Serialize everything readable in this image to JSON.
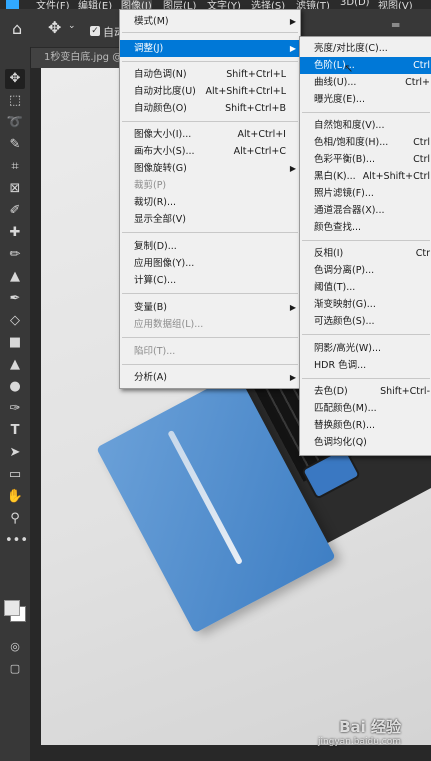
{
  "menubar": {
    "items": [
      "文件(F)",
      "编辑(E)",
      "图像(I)",
      "图层(L)",
      "文字(Y)",
      "选择(S)",
      "滤镜(T)",
      "3D(D)",
      "视图(V)"
    ]
  },
  "optbar": {
    "autoselect_label": "自动"
  },
  "tab": {
    "title": "1秒变白底.jpg @"
  },
  "image_menu": {
    "items": [
      {
        "label": "模式(M)",
        "shortcut": "",
        "submenu": true
      },
      {
        "label": "调整(J)",
        "shortcut": "",
        "submenu": true
      },
      {
        "label": "自动色调(N)",
        "shortcut": "Shift+Ctrl+L"
      },
      {
        "label": "自动对比度(U)",
        "shortcut": "Alt+Shift+Ctrl+L"
      },
      {
        "label": "自动颜色(O)",
        "shortcut": "Shift+Ctrl+B"
      },
      {
        "label": "图像大小(I)...",
        "shortcut": "Alt+Ctrl+I"
      },
      {
        "label": "画布大小(S)...",
        "shortcut": "Alt+Ctrl+C"
      },
      {
        "label": "图像旋转(G)",
        "shortcut": "",
        "submenu": true
      },
      {
        "label": "裁剪(P)",
        "shortcut": ""
      },
      {
        "label": "裁切(R)...",
        "shortcut": ""
      },
      {
        "label": "显示全部(V)",
        "shortcut": ""
      },
      {
        "label": "复制(D)...",
        "shortcut": ""
      },
      {
        "label": "应用图像(Y)...",
        "shortcut": ""
      },
      {
        "label": "计算(C)...",
        "shortcut": ""
      },
      {
        "label": "变量(B)",
        "shortcut": "",
        "submenu": true
      },
      {
        "label": "应用数据组(L)...",
        "shortcut": ""
      },
      {
        "label": "陷印(T)...",
        "shortcut": ""
      },
      {
        "label": "分析(A)",
        "shortcut": "",
        "submenu": true
      }
    ]
  },
  "adjust_menu": {
    "items": [
      {
        "label": "亮度/对比度(C)...",
        "shortcut": ""
      },
      {
        "label": "色阶(L)...",
        "shortcut": "Ctrl"
      },
      {
        "label": "曲线(U)...",
        "shortcut": "Ctrl+"
      },
      {
        "label": "曝光度(E)...",
        "shortcut": ""
      },
      {
        "label": "自然饱和度(V)...",
        "shortcut": ""
      },
      {
        "label": "色相/饱和度(H)...",
        "shortcut": "Ctrl"
      },
      {
        "label": "色彩平衡(B)...",
        "shortcut": "Ctrl"
      },
      {
        "label": "黑白(K)...",
        "shortcut": "Alt+Shift+Ctrl"
      },
      {
        "label": "照片滤镜(F)...",
        "shortcut": ""
      },
      {
        "label": "通道混合器(X)...",
        "shortcut": ""
      },
      {
        "label": "颜色查找...",
        "shortcut": ""
      },
      {
        "label": "反相(I)",
        "shortcut": "Ctr"
      },
      {
        "label": "色调分离(P)...",
        "shortcut": ""
      },
      {
        "label": "阈值(T)...",
        "shortcut": ""
      },
      {
        "label": "渐变映射(G)...",
        "shortcut": ""
      },
      {
        "label": "可选颜色(S)...",
        "shortcut": ""
      },
      {
        "label": "阴影/高光(W)...",
        "shortcut": ""
      },
      {
        "label": "HDR 色调...",
        "shortcut": ""
      },
      {
        "label": "去色(D)",
        "shortcut": "Shift+Ctrl-"
      },
      {
        "label": "匹配颜色(M)...",
        "shortcut": ""
      },
      {
        "label": "替换颜色(R)...",
        "shortcut": ""
      },
      {
        "label": "色调均化(Q)",
        "shortcut": ""
      }
    ]
  },
  "watermark": {
    "brand": "Bai 经验",
    "url": "jingyan.baidu.com"
  }
}
